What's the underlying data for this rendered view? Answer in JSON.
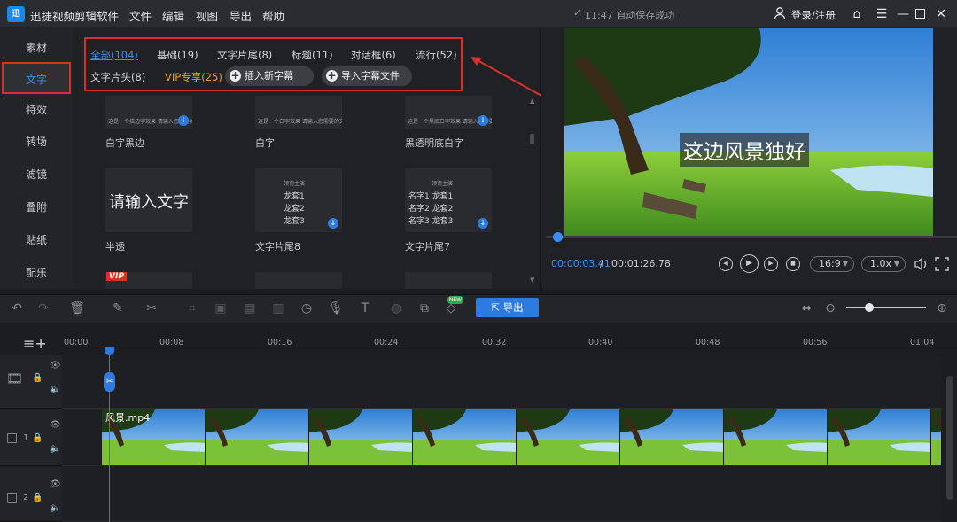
{
  "app": {
    "name": "迅捷视频剪辑软件",
    "logo_text": "迅"
  },
  "menu": [
    "文件",
    "编辑",
    "视图",
    "导出",
    "帮助"
  ],
  "save_status": "11:47 自动保存成功",
  "login": "登录/注册",
  "left_nav": [
    "素材",
    "文字",
    "特效",
    "转场",
    "滤镜",
    "叠附",
    "贴纸",
    "配乐"
  ],
  "left_nav_active": "文字",
  "tabs": {
    "row1": [
      "全部(104)",
      "基础(19)",
      "文字片尾(8)",
      "标题(11)",
      "对话框(6)",
      "流行(52)"
    ],
    "row2": [
      "文字片头(8)",
      "VIP专享(25)"
    ],
    "insert_button": "插入新字幕",
    "import_button": "导入字幕文件"
  },
  "templates": [
    {
      "label": "白字黑边",
      "preview": "这是一个描边字效果 请输入您需要的文字"
    },
    {
      "label": "白字",
      "preview": "这是一个白字效果 请输入您需要的文字"
    },
    {
      "label": "黑透明底白字",
      "preview": "这是一个黑底白字效果 请输入您需要的文字"
    },
    {
      "label": "半透",
      "preview": "请输入文字"
    },
    {
      "label": "文字片尾8",
      "preview": [
        "领衔主演",
        "龙套1",
        "龙套2",
        "龙套3"
      ]
    },
    {
      "label": "文字片尾7",
      "preview": [
        "领衔主演",
        "名字1 龙套1",
        "名字2 龙套2",
        "名字3 龙套3"
      ]
    }
  ],
  "vip_badge": "VIP",
  "preview": {
    "subtitle": "这边风景独好",
    "current_time": "00:00:03.41",
    "separator": "/",
    "total_time": "00:01:26.78",
    "aspect_ratio": "16:9",
    "speed": "1.0x",
    "progress": 0.04
  },
  "toolbar": {
    "export_label": "导出",
    "new_badge": "NEW"
  },
  "ruler": [
    "00:00",
    "00:08",
    "00:16",
    "00:24",
    "00:32",
    "00:40",
    "00:48",
    "00:56",
    "01:04"
  ],
  "tracks": [
    {
      "label": ""
    },
    {
      "label": "1"
    },
    {
      "label": "2"
    }
  ],
  "clip": {
    "name": "风景.mp4"
  },
  "colors": {
    "accent": "#2d7be0",
    "highlight_border": "#d9302a",
    "vip": "#f0a020"
  }
}
